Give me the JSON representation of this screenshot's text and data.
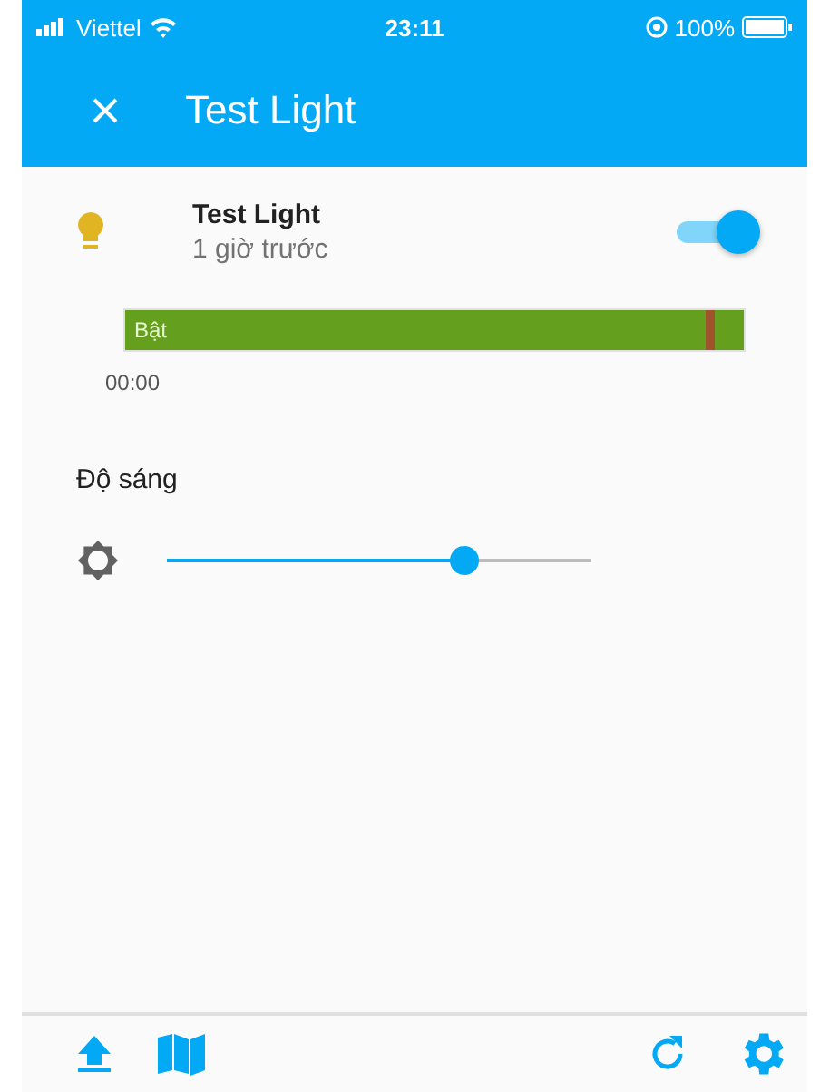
{
  "status_bar": {
    "carrier": "Viettel",
    "time": "23:11",
    "battery": "100%"
  },
  "header": {
    "title": "Test Light"
  },
  "entity": {
    "name": "Test Light",
    "last_changed": "1 giờ trước",
    "on": true
  },
  "history": {
    "state_label": "Bật",
    "time_tick": "00:00"
  },
  "brightness": {
    "label": "Độ sáng",
    "level": 0.7
  }
}
